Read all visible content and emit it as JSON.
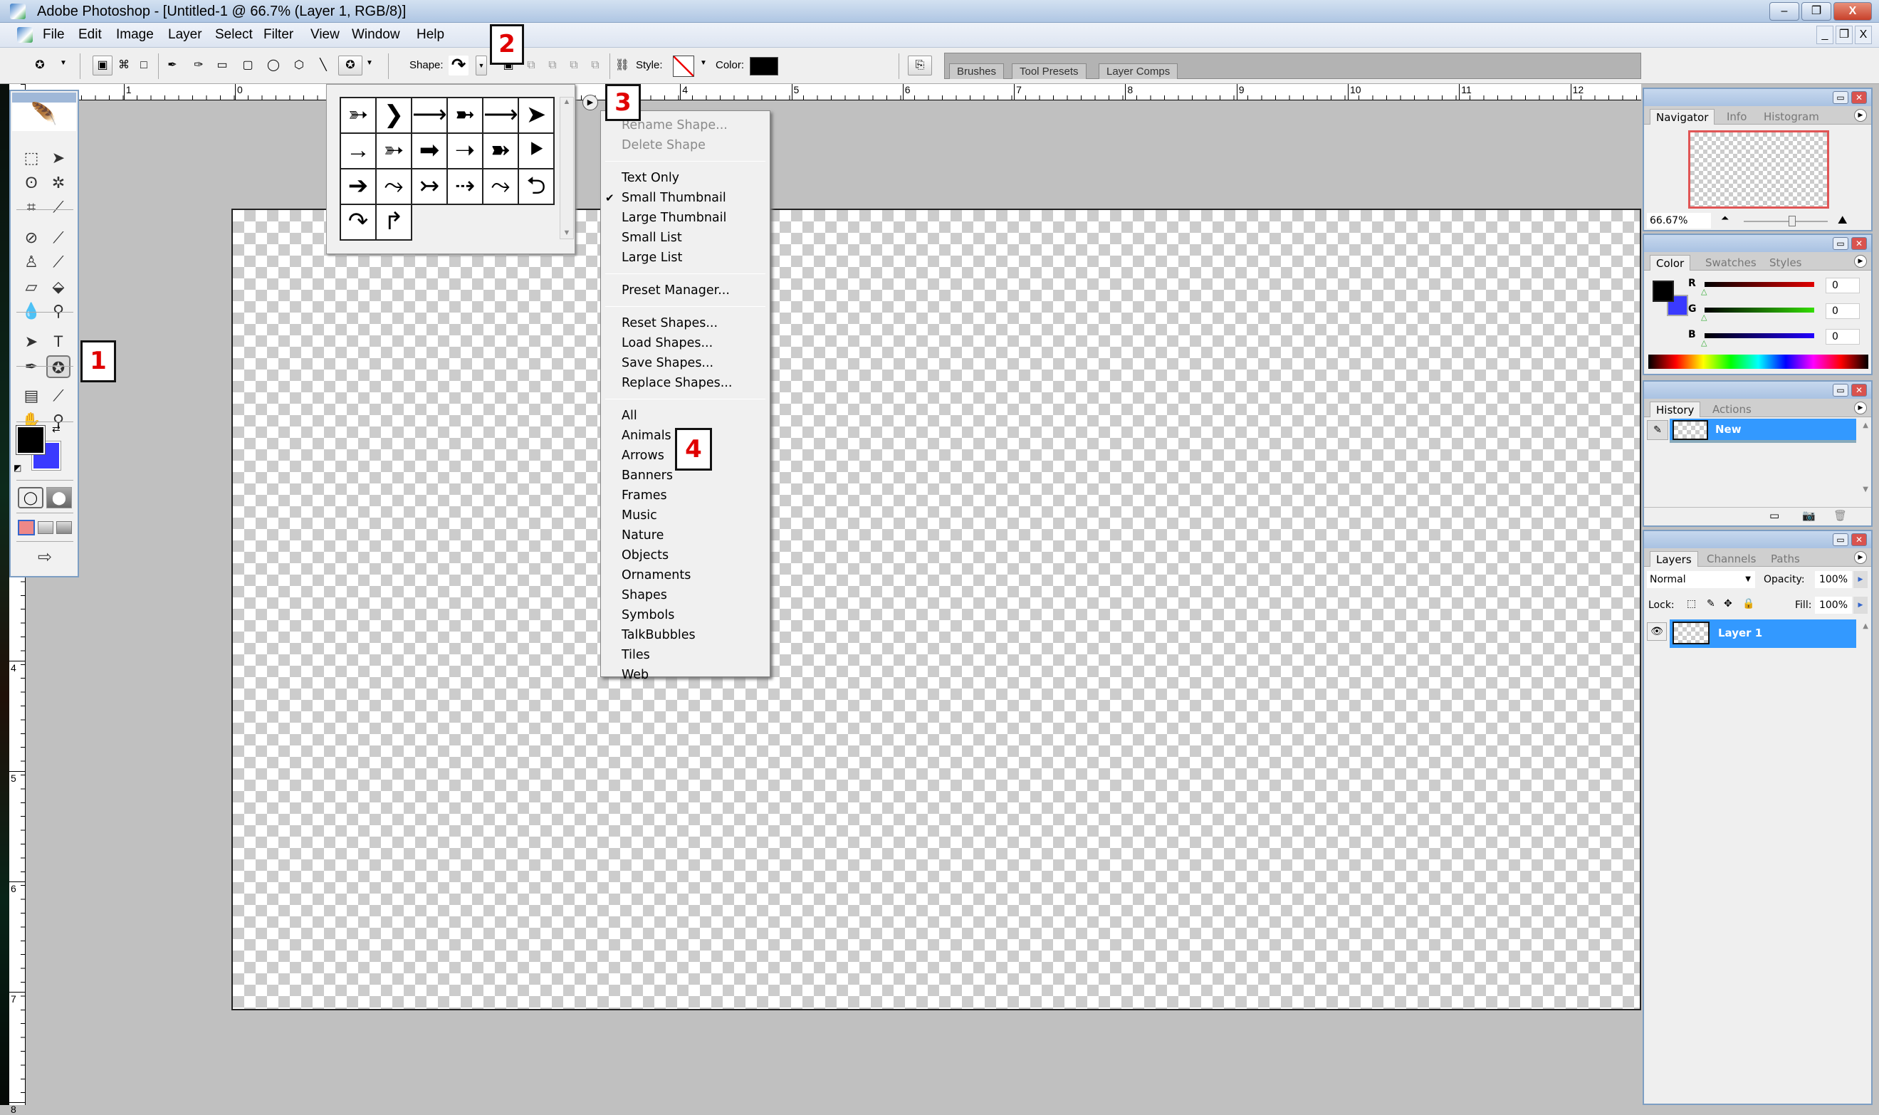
{
  "window": {
    "title": "Adobe Photoshop - [Untitled-1 @ 66.7% (Layer 1, RGB/8)]",
    "minimize": "–",
    "restore": "❐",
    "close": "X"
  },
  "menubar": {
    "items": [
      "File",
      "Edit",
      "Image",
      "Layer",
      "Select",
      "Filter",
      "View",
      "Window",
      "Help"
    ],
    "doc_controls": [
      "_",
      "❐",
      "X"
    ]
  },
  "options": {
    "shape_label": "Shape:",
    "style_label": "Style:",
    "color_label": "Color:",
    "color_value": "#000000",
    "current_shape_icon": "curved-arrow-icon"
  },
  "palette_well": {
    "tabs": [
      "Brushes",
      "Tool Presets",
      "Layer Comps"
    ]
  },
  "rulers": {
    "top_labels": [
      "1",
      "0",
      "4",
      "5",
      "6",
      "7",
      "8",
      "9",
      "10",
      "11",
      "12"
    ],
    "left_labels": [
      "4",
      "5",
      "6",
      "7",
      "8"
    ]
  },
  "toolbox": {
    "tools": [
      {
        "name": "rectangular-marquee",
        "glyph": "⬚"
      },
      {
        "name": "move",
        "glyph": "➤"
      },
      {
        "name": "lasso",
        "glyph": "ʘ"
      },
      {
        "name": "magic-wand",
        "glyph": "✲"
      },
      {
        "name": "crop",
        "glyph": "⌗"
      },
      {
        "name": "slice",
        "glyph": "⟋"
      },
      {
        "name": "healing-brush",
        "glyph": "⊘"
      },
      {
        "name": "brush",
        "glyph": "⟋"
      },
      {
        "name": "clone-stamp",
        "glyph": "♙"
      },
      {
        "name": "history-brush",
        "glyph": "⟋"
      },
      {
        "name": "eraser",
        "glyph": "▱"
      },
      {
        "name": "paint-bucket",
        "glyph": "⬙"
      },
      {
        "name": "blur",
        "glyph": "💧"
      },
      {
        "name": "dodge",
        "glyph": "⚲"
      },
      {
        "name": "path-selection",
        "glyph": "➤"
      },
      {
        "name": "type",
        "glyph": "T"
      },
      {
        "name": "pen",
        "glyph": "✒"
      },
      {
        "name": "custom-shape",
        "glyph": "✪"
      },
      {
        "name": "notes",
        "glyph": "▤"
      },
      {
        "name": "eyedropper",
        "glyph": "⟋"
      },
      {
        "name": "hand",
        "glyph": "✋"
      },
      {
        "name": "zoom",
        "glyph": "⚲"
      }
    ],
    "foreground_color": "#000000",
    "background_color": "#3a3aff"
  },
  "shape_picker": {
    "shapes": [
      {
        "name": "arrow-feathered",
        "glyph": "➳"
      },
      {
        "name": "arrow-chevron",
        "glyph": "❯"
      },
      {
        "name": "arrow-thin-line",
        "glyph": "⟶"
      },
      {
        "name": "arrow-double-head",
        "glyph": "➼"
      },
      {
        "name": "arrow-thin",
        "glyph": "⟶"
      },
      {
        "name": "arrow-triangle",
        "glyph": "➤"
      },
      {
        "name": "arrow-open",
        "glyph": "→"
      },
      {
        "name": "arrow-feathered-light",
        "glyph": "➳"
      },
      {
        "name": "arrow-block",
        "glyph": "➡"
      },
      {
        "name": "arrow-slim",
        "glyph": "➝"
      },
      {
        "name": "arrow-bold-tail",
        "glyph": "➽"
      },
      {
        "name": "arrow-pentagon",
        "glyph": "⯈"
      },
      {
        "name": "arrow-solid",
        "glyph": "➔"
      },
      {
        "name": "arrow-wavy",
        "glyph": "⤳"
      },
      {
        "name": "arrow-tail",
        "glyph": "↣"
      },
      {
        "name": "arrow-thin-feather",
        "glyph": "⇢"
      },
      {
        "name": "arrow-squiggle",
        "glyph": "⤳"
      },
      {
        "name": "arrow-u-turn",
        "glyph": "⮌"
      },
      {
        "name": "arrow-curved",
        "glyph": "↷"
      },
      {
        "name": "arrow-corner",
        "glyph": "↱"
      }
    ],
    "scroll_up": "▲",
    "scroll_down": "▼",
    "flyout_icon": "▶"
  },
  "flyout_menu": {
    "groups": [
      [
        {
          "label": "Rename Shape...",
          "disabled": true
        },
        {
          "label": "Delete Shape",
          "disabled": true
        }
      ],
      [
        {
          "label": "Text Only"
        },
        {
          "label": "Small Thumbnail",
          "checked": true
        },
        {
          "label": "Large Thumbnail"
        },
        {
          "label": "Small List"
        },
        {
          "label": "Large List"
        }
      ],
      [
        {
          "label": "Preset Manager..."
        }
      ],
      [
        {
          "label": "Reset Shapes..."
        },
        {
          "label": "Load Shapes..."
        },
        {
          "label": "Save Shapes..."
        },
        {
          "label": "Replace Shapes..."
        }
      ],
      [
        {
          "label": "All"
        },
        {
          "label": "Animals"
        },
        {
          "label": "Arrows"
        },
        {
          "label": "Banners"
        },
        {
          "label": "Frames"
        },
        {
          "label": "Music"
        },
        {
          "label": "Nature"
        },
        {
          "label": "Objects"
        },
        {
          "label": "Ornaments"
        },
        {
          "label": "Shapes"
        },
        {
          "label": "Symbols"
        },
        {
          "label": "TalkBubbles"
        },
        {
          "label": "Tiles"
        },
        {
          "label": "Web"
        }
      ]
    ],
    "check": "✔"
  },
  "callouts": [
    "1",
    "2",
    "3",
    "4"
  ],
  "navigator": {
    "tabs": [
      "Navigator",
      "Info",
      "Histogram"
    ],
    "zoom": "66.67%",
    "zoom_percent": 66.67
  },
  "color_panel": {
    "tabs": [
      "Color",
      "Swatches",
      "Styles"
    ],
    "channels": [
      {
        "label": "R",
        "value": "0",
        "color": "#e00000"
      },
      {
        "label": "G",
        "value": "0",
        "color": "#33dd00"
      },
      {
        "label": "B",
        "value": "0",
        "color": "#2200ff"
      }
    ]
  },
  "history": {
    "tabs": [
      "History",
      "Actions"
    ],
    "items": [
      "New"
    ]
  },
  "layers": {
    "tabs": [
      "Layers",
      "Channels",
      "Paths"
    ],
    "blend_mode": "Normal",
    "opacity_label": "Opacity:",
    "opacity": "100%",
    "lock_label": "Lock:",
    "fill_label": "Fill:",
    "fill": "100%",
    "items": [
      "Layer 1"
    ]
  }
}
